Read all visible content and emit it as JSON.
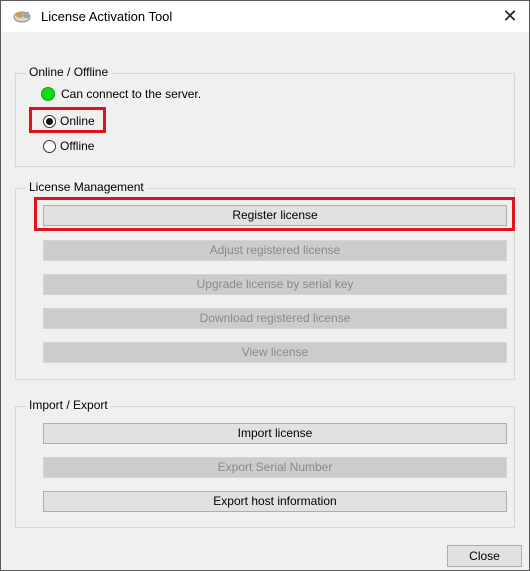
{
  "window": {
    "title": "License Activation Tool",
    "close_glyph": "✕"
  },
  "online_offline": {
    "legend": "Online / Offline",
    "status_text": "Can connect to the server.",
    "status_color": "#10dd10",
    "options": [
      {
        "label": "Online",
        "selected": true
      },
      {
        "label": "Offline",
        "selected": false
      }
    ]
  },
  "license_management": {
    "legend": "License Management",
    "buttons": [
      {
        "label": "Register license",
        "enabled": true
      },
      {
        "label": "Adjust registered license",
        "enabled": false
      },
      {
        "label": "Upgrade license by serial key",
        "enabled": false
      },
      {
        "label": "Download registered license",
        "enabled": false
      },
      {
        "label": "View license",
        "enabled": false
      }
    ]
  },
  "import_export": {
    "legend": "Import / Export",
    "buttons": [
      {
        "label": "Import license",
        "enabled": true
      },
      {
        "label": "Export Serial Number",
        "enabled": false
      },
      {
        "label": "Export host information",
        "enabled": true
      }
    ]
  },
  "footer": {
    "close_label": "Close"
  },
  "highlight_color": "#e1141e"
}
